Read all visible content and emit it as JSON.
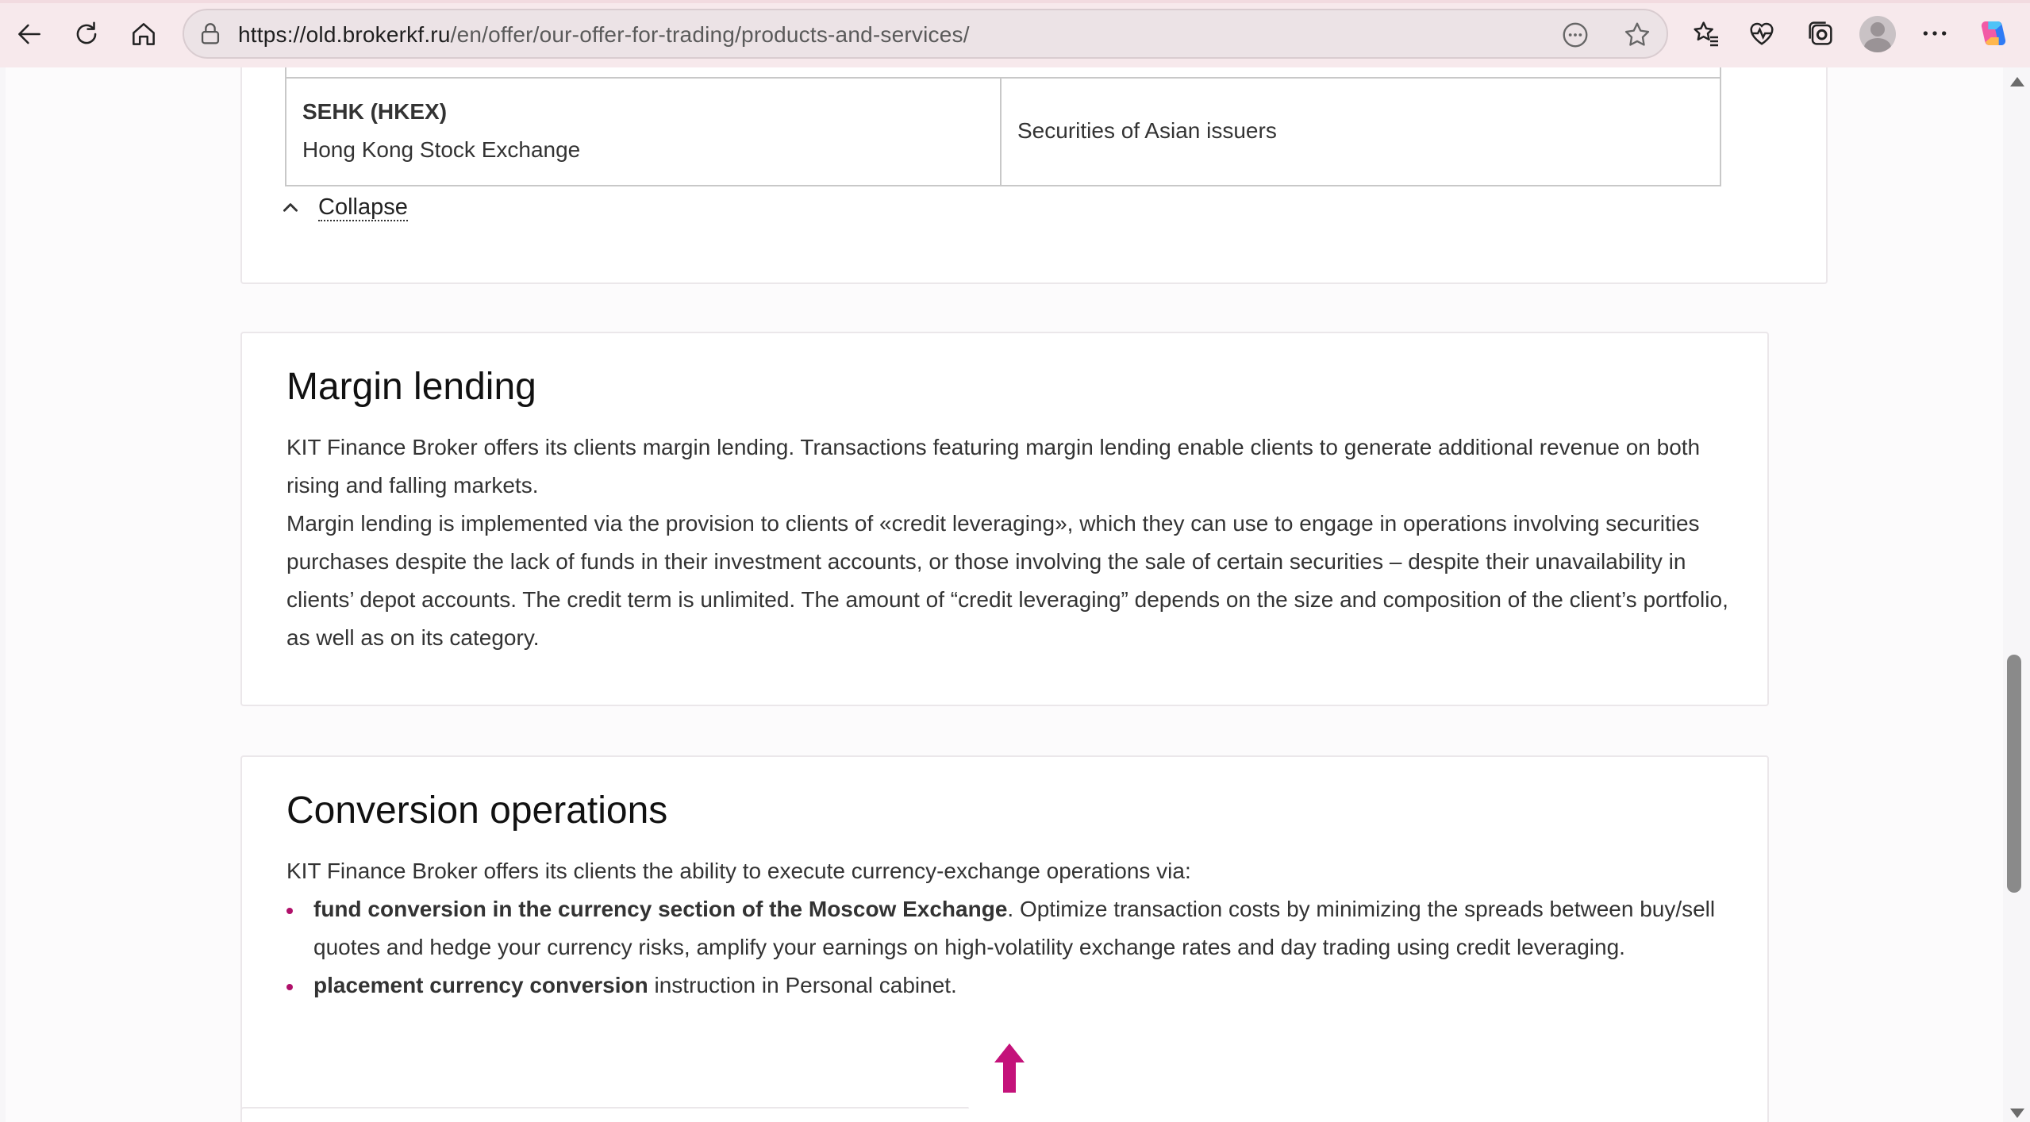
{
  "browser": {
    "url_host": "https://old.brokerkf.ru",
    "url_path": "/en/offer/our-offer-for-trading/products-and-services/",
    "icons": [
      "back-icon",
      "refresh-icon",
      "home-icon",
      "lock-icon",
      "reading-mode-icon",
      "favorite-star-icon",
      "favorites-icon",
      "health-icon",
      "collections-icon",
      "profile-icon",
      "more-icon",
      "copilot-icon"
    ]
  },
  "exchanges_table": {
    "row": {
      "exchange_name": "SEHK (HKEX)",
      "exchange_full": "Hong Kong Stock Exchange",
      "instruments": "Securities of Asian issuers"
    },
    "collapse_label": "Collapse"
  },
  "margin_lending": {
    "title": "Margin lending",
    "paragraph1": "KIT Finance Broker offers its clients margin lending. Transactions featuring margin lending enable clients to generate additional revenue on both rising and falling markets.",
    "paragraph2": "Margin lending is implemented via the provision to clients of «credit leveraging», which they can use to engage in operations involving securities purchases despite the lack of funds in their investment accounts, or those involving the sale of certain securities – despite their unavailability in clients’ depot accounts. The credit term is unlimited. The amount of “credit leveraging” depends on the size and composition of the client’s portfolio, as well as on its category."
  },
  "conversion": {
    "title": "Conversion operations",
    "intro": "KIT Finance Broker offers its clients the ability to execute currency-exchange operations via:",
    "items": [
      {
        "bold": "fund conversion in the currency section of the Moscow Exchange",
        "rest": ". Optimize transaction costs by minimizing the spreads between buy/sell quotes and hedge your currency risks, amplify your earnings on high-volatility exchange rates and day trading using credit leveraging."
      },
      {
        "bold": "placement currency conversion",
        "rest": " instruction in Personal cabinet."
      }
    ]
  },
  "colors": {
    "accent": "#b0106a",
    "browser_frame": "#f7e9ec"
  }
}
